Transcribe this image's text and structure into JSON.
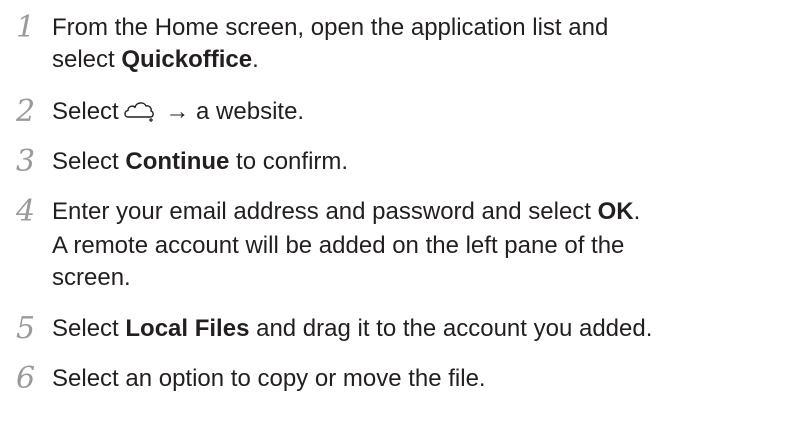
{
  "steps": [
    {
      "number": "1",
      "line1": "From the Home screen, open the application list and",
      "line2_pre": "select ",
      "line2_bold": "Quickoffice",
      "line2_post": "."
    },
    {
      "number": "2",
      "pre": "Select",
      "icon": "cloud-add-icon",
      "post": " → a website."
    },
    {
      "number": "3",
      "pre": "Select ",
      "bold": "Continue",
      "post": " to confirm."
    },
    {
      "number": "4",
      "pre": "Enter your email address and password and select ",
      "bold": "OK",
      "post": ".",
      "note_line1": "A remote account will be added on the left pane of the",
      "note_line2": "screen."
    },
    {
      "number": "5",
      "pre": "Select ",
      "bold": "Local Files",
      "post": " and drag it to the account you added."
    },
    {
      "number": "6",
      "text": "Select an option to copy or move the file."
    }
  ]
}
